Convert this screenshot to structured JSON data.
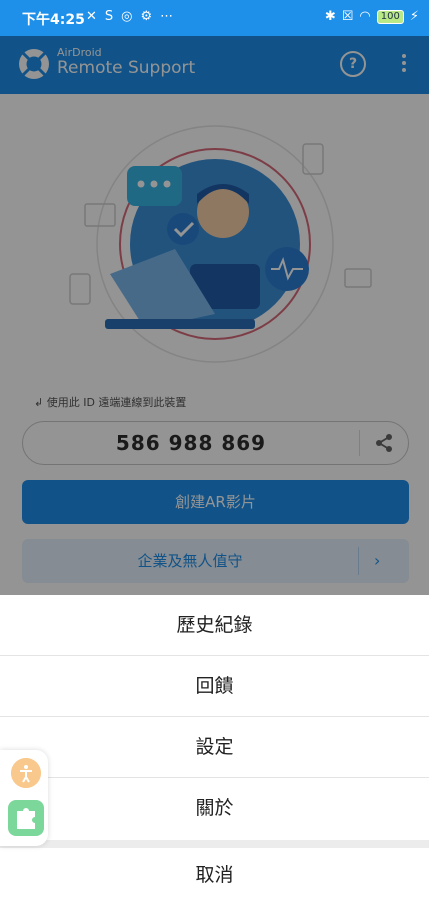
{
  "status_bar": {
    "time": "下午4:25",
    "battery": "100",
    "left_icons": [
      "vibrate-off-icon",
      "s-icon",
      "vpn-icon",
      "settings-icon",
      "more-dots-icon"
    ],
    "right_icons": [
      "bluetooth-icon",
      "no-sim-icon",
      "wifi-icon",
      "battery-icon",
      "charging-icon"
    ]
  },
  "app_bar": {
    "brand_small": "AirDroid",
    "brand_title": "Remote Support",
    "help_label": "?"
  },
  "main": {
    "connect_hint": "使用此 ID 遠端連線到此裝置",
    "device_id": "586 988 869",
    "create_ar_button": "創建AR影片",
    "enterprise_button": "企業及無人值守",
    "enterprise_arrow": "›"
  },
  "action_sheet": {
    "items": [
      "歷史紀錄",
      "回饋",
      "設定",
      "關於"
    ],
    "cancel": "取消"
  },
  "colors": {
    "brand_blue": "#1e90ea",
    "overlay": "rgba(0,0,0,0.42)"
  }
}
